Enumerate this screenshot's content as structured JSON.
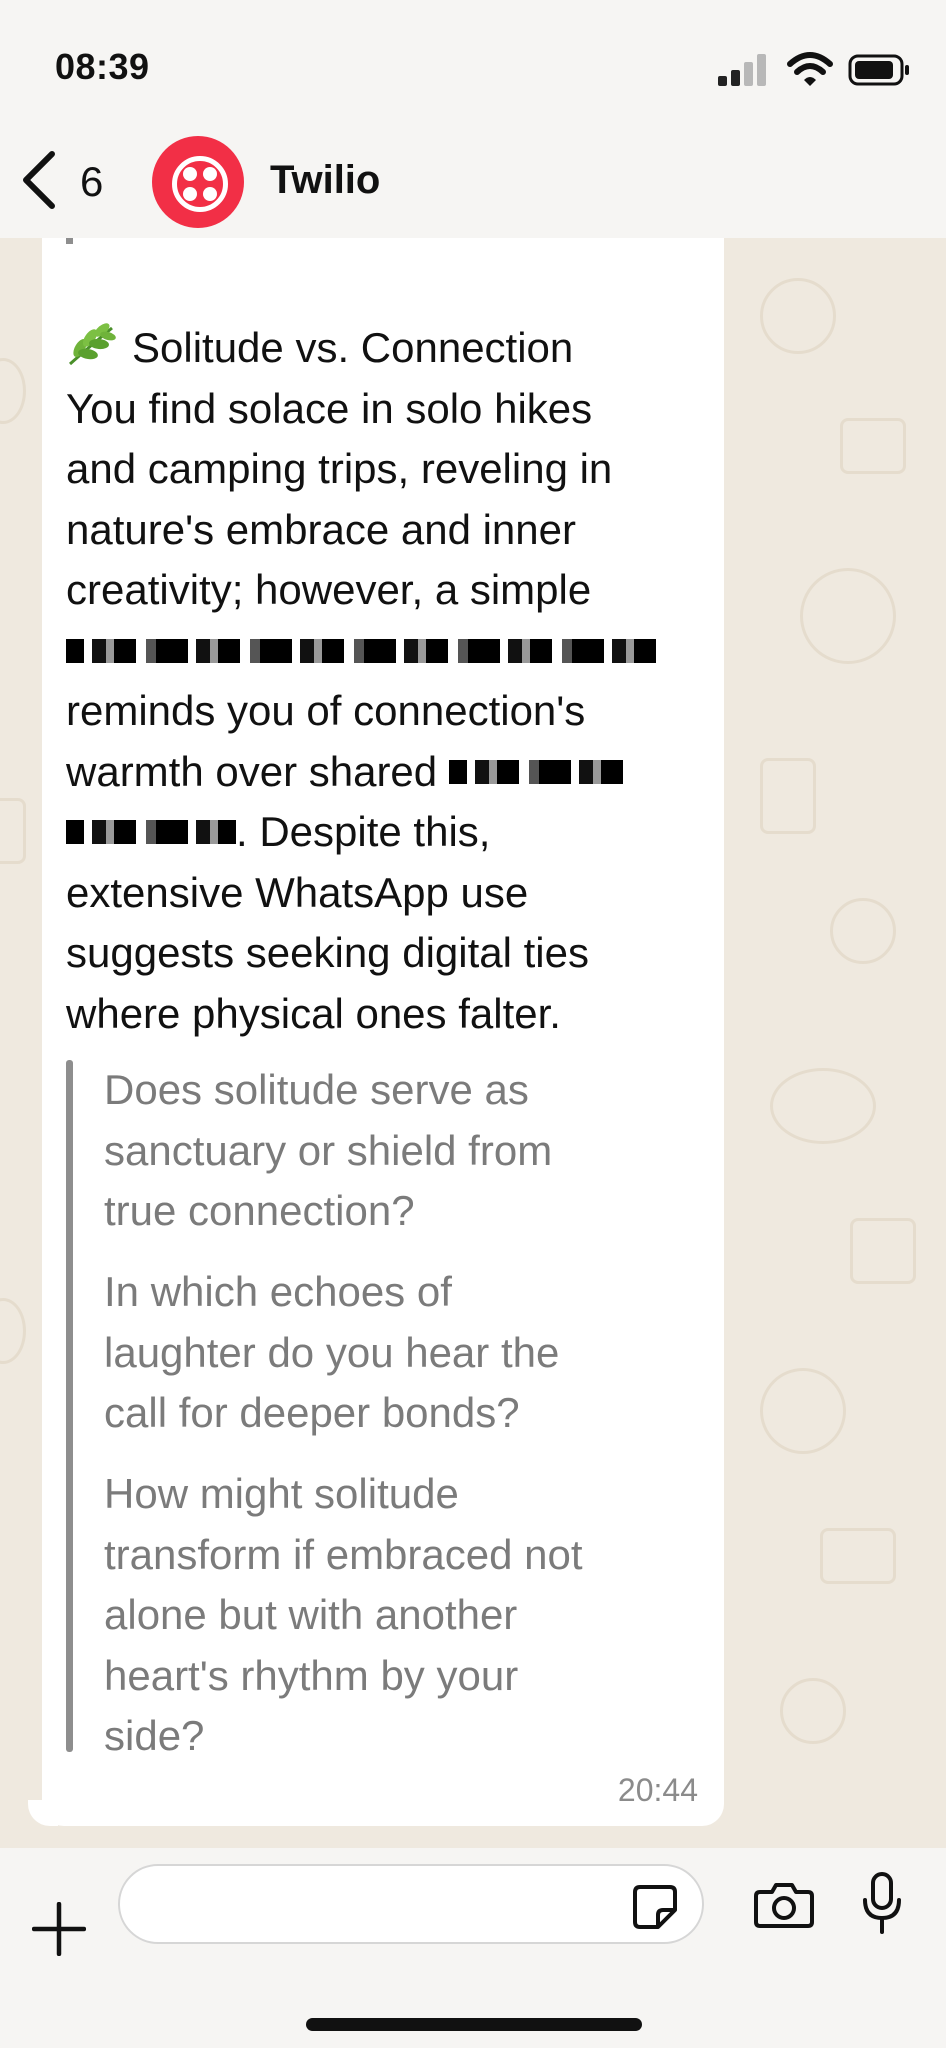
{
  "status_bar": {
    "time": "08:39",
    "icons": [
      "cellular-signal-icon",
      "wifi-icon",
      "battery-icon"
    ]
  },
  "header": {
    "back_count": "6",
    "contact_name": "Twilio",
    "avatar": "twilio-logo"
  },
  "message": {
    "heading": "Solitude vs. Connection",
    "heading_icon": "leaf-icon",
    "body_lines": [
      "You find solace in solo hikes",
      "and camping trips, reveling in",
      "nature's embrace and inner",
      "creativity; however, a simple",
      "",
      "reminds you of connection's",
      "warmth over shared",
      ". Despite this,",
      "extensive WhatsApp use",
      "suggests seeking digital ties",
      "where physical ones falter."
    ],
    "questions": [
      [
        "Does solitude serve as",
        "sanctuary or shield from",
        "true connection?"
      ],
      [
        "In which echoes of",
        "laughter do you hear the",
        "call for deeper bonds?"
      ],
      [
        "How might solitude",
        "transform if embraced not",
        "alone but with another",
        "heart's rhythm by your",
        "side?"
      ]
    ],
    "time": "20:44"
  },
  "composer": {
    "input_value": "",
    "input_placeholder": "",
    "icons": [
      "plus-icon",
      "sticker-icon",
      "camera-icon",
      "microphone-icon"
    ]
  },
  "colors": {
    "twilio_red": "#f22f46",
    "chat_background": "#efe9df",
    "bubble": "#ffffff",
    "quote_text": "#7b7b7b",
    "quote_bar": "#8e8e8e"
  }
}
